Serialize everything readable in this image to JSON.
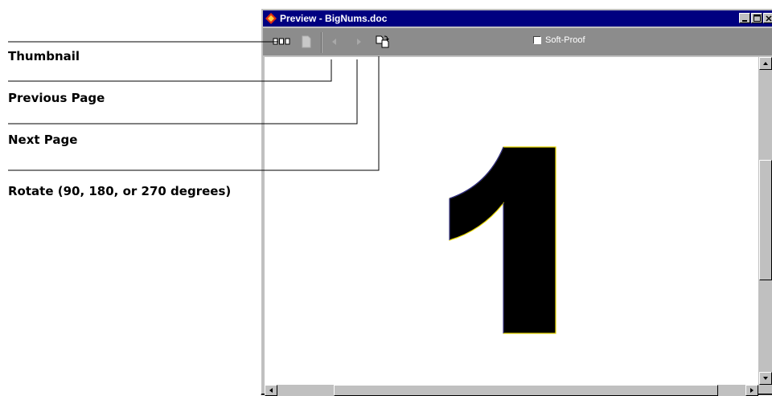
{
  "callouts": [
    {
      "label": "Thumbnail"
    },
    {
      "label": "Previous Page"
    },
    {
      "label": "Next Page"
    },
    {
      "label": "Rotate (90, 180, or 270 degrees)"
    }
  ],
  "window": {
    "title": "Preview - BigNums.doc",
    "softproof_label": "Soft-Proof",
    "softproof_checked": false,
    "page_number": "1"
  },
  "colors": {
    "titlebar": "#000080",
    "toolbar": "#8c8c8c",
    "chrome": "#c0c0c0"
  },
  "icons": [
    "thumbnail-icon",
    "page-icon",
    "previous-page-icon",
    "next-page-icon",
    "rotate-icon"
  ]
}
